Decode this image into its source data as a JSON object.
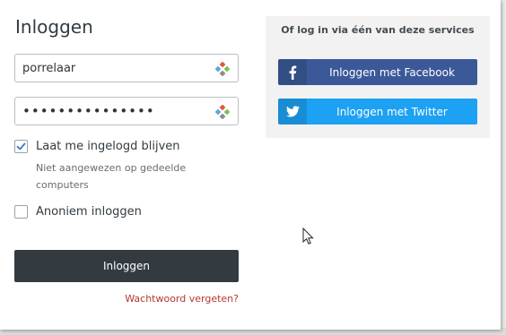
{
  "login": {
    "title": "Inloggen",
    "username_value": "porrelaar",
    "password_value": "•••••••••••••••",
    "remember": {
      "label": "Laat me ingelogd blijven",
      "checked": true,
      "hint": "Niet aangewezen op gedeelde computers"
    },
    "anonymous": {
      "label": "Anoniem inloggen",
      "checked": false
    },
    "submit_label": "Inloggen",
    "forgot_label": "Wachtwoord vergeten?"
  },
  "social": {
    "title": "Of log in via één van deze services",
    "facebook_label": "Inloggen met Facebook",
    "twitter_label": "Inloggen met Twitter",
    "facebook_icon": "facebook-icon",
    "twitter_icon": "twitter-icon"
  },
  "colors": {
    "primary": "#333b41",
    "facebook": "#3b5998",
    "twitter": "#1da1f2",
    "link": "#b5372d",
    "checkbox_accent": "#3a7bd5"
  }
}
